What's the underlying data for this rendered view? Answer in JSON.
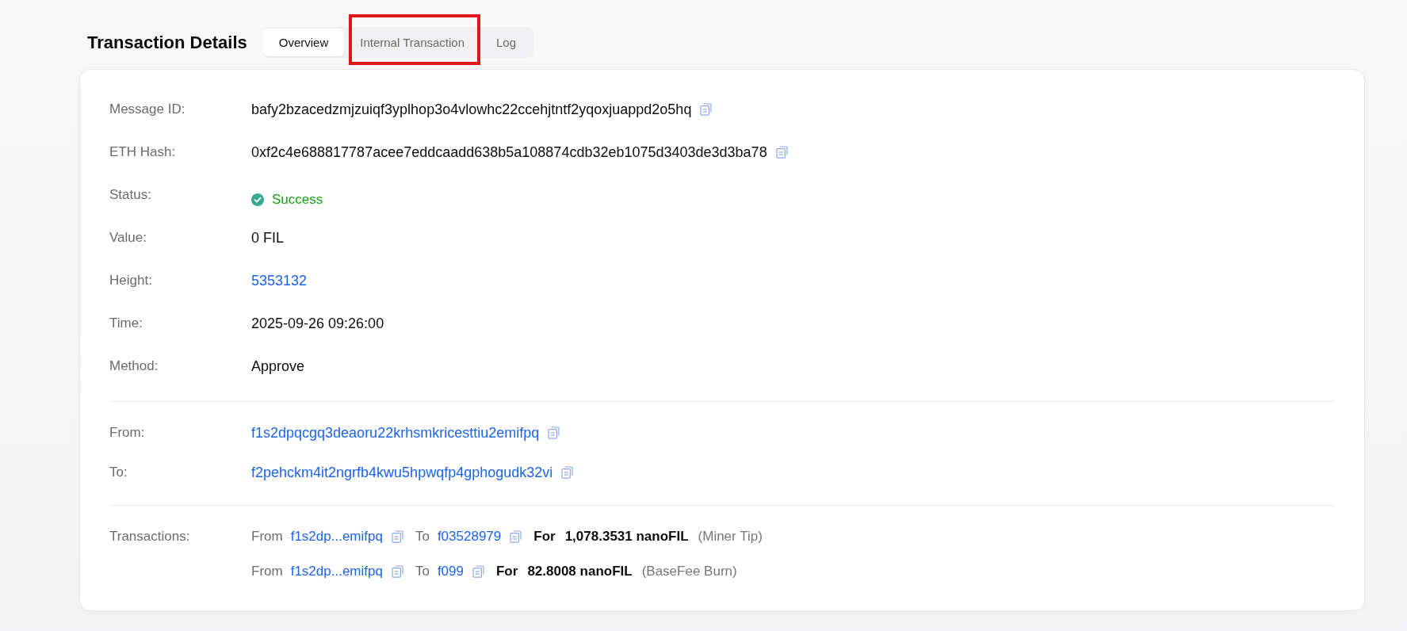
{
  "header": {
    "title": "Transaction Details",
    "tabs": [
      {
        "label": "Overview",
        "selected": true,
        "highlighted": false
      },
      {
        "label": "Internal Transaction",
        "selected": false,
        "highlighted": true
      },
      {
        "label": "Log",
        "selected": false,
        "highlighted": false
      }
    ]
  },
  "details": {
    "sections": [
      {
        "rows": [
          {
            "label": "Message ID:",
            "kind": "text",
            "value": "bafy2bzacedzmjzuiqf3yplhop3o4vlowhc22ccehjtntf2yqoxjuappd2o5hq",
            "copyable": true
          },
          {
            "label": "ETH Hash:",
            "kind": "text",
            "value": "0xf2c4e688817787acee7eddcaadd638b5a108874cdb32eb1075d3403de3d3ba78",
            "copyable": true
          },
          {
            "label": "Status:",
            "kind": "status",
            "value": "Success",
            "copyable": false
          },
          {
            "label": "Value:",
            "kind": "text",
            "value": "0 FIL",
            "copyable": false
          },
          {
            "label": "Height:",
            "kind": "link",
            "value": "5353132",
            "copyable": false
          },
          {
            "label": "Time:",
            "kind": "text",
            "value": "2025-09-26 09:26:00",
            "copyable": false
          },
          {
            "label": "Method:",
            "kind": "text",
            "value": "Approve",
            "copyable": false
          }
        ]
      },
      {
        "rows": [
          {
            "label": "From:",
            "kind": "link",
            "value": "f1s2dpqcgq3deaoru22krhsmkricesttiu2emifpq",
            "copyable": true
          },
          {
            "label": "To:",
            "kind": "link",
            "value": "f2pehckm4it2ngrfb4kwu5hpwqfp4gphogudk32vi",
            "copyable": true
          }
        ]
      }
    ]
  },
  "transactions": {
    "label": "Transactions:",
    "rows": [
      {
        "from_word": "From",
        "from": "f1s2dp...emifpq",
        "to_word": "To",
        "to": "f03528979",
        "for_word": "For",
        "amount": "1,078.3531 nanoFIL",
        "note": "(Miner Tip)"
      },
      {
        "from_word": "From",
        "from": "f1s2dp...emifpq",
        "to_word": "To",
        "to": "f099",
        "for_word": "For",
        "amount": "82.8008 nanoFIL",
        "note": "(BaseFee Burn)"
      }
    ]
  }
}
